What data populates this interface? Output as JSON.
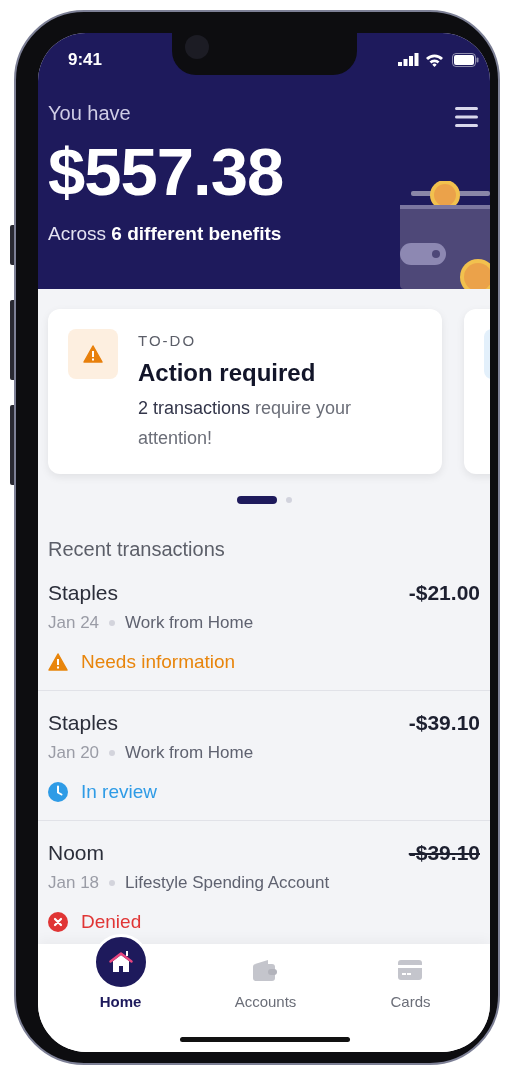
{
  "status_bar": {
    "time": "9:41"
  },
  "header": {
    "label": "You have",
    "balance": "$557.38",
    "subtitle": "Across **6 different benefits**"
  },
  "cards": [
    {
      "kind": "warning",
      "tag": "TO-DO",
      "title": "Action required",
      "body": "**2 transactions** require your attention!"
    },
    {
      "kind": "info"
    }
  ],
  "pager": [
    {
      "selected": true
    },
    {
      "selected": false
    }
  ],
  "section_title": "Recent transactions",
  "transactions": [
    {
      "name": "Staples",
      "amount": "-$21.00",
      "struck": false,
      "date": "Jan 24",
      "account": "Work from Home",
      "kind": "needs_info",
      "status_label": "Needs information"
    },
    {
      "name": "Staples",
      "amount": "-$39.10",
      "struck": false,
      "date": "Jan 20",
      "account": "Work from Home",
      "kind": "review",
      "status_label": "In review"
    },
    {
      "name": "Noom",
      "amount": "-$39.10",
      "struck": true,
      "date": "Jan 18",
      "account": "Lifestyle Spending Account",
      "kind": "denied",
      "status_label": "Denied"
    }
  ],
  "tab_bar": [
    {
      "kind": "home",
      "label": "Home",
      "selected": true
    },
    {
      "kind": "accounts",
      "label": "Accounts",
      "selected": false
    },
    {
      "kind": "cards",
      "label": "Cards",
      "selected": false
    }
  ]
}
